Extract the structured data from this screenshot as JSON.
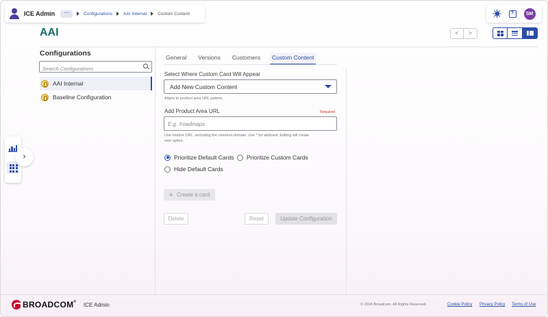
{
  "header": {
    "app_title": "ICE Admin",
    "more_label": "···",
    "breadcrumbs": [
      "Configurations",
      "AAI Internal"
    ],
    "current": "Custom Content",
    "avatar_initials": "SM"
  },
  "page": {
    "title": "AAI",
    "nav_prev": "<",
    "nav_next": ">"
  },
  "configs": {
    "title": "Configurations",
    "search_placeholder": "Search Configurations",
    "items": [
      {
        "label": "AAI Internal",
        "active": true
      },
      {
        "label": "Baseline Configuration",
        "active": false
      }
    ]
  },
  "tabs": [
    "General",
    "Versions",
    "Customers",
    "Custom Content"
  ],
  "form": {
    "select_label": "Select Where Custom Card Will Appear",
    "select_value": "Add New Custom Content",
    "select_help": "Aligns to product area URL pattern.",
    "url_label": "Add Product Area URL",
    "required": "Required",
    "url_placeholder": "E.g. /roadmaps",
    "url_help_1": "Use relative URL, excluding the common domain. Use * for wildcard. Editing will create",
    "url_help_2": "new option.",
    "radios": [
      {
        "label": "Prioritize Default Cards",
        "checked": true
      },
      {
        "label": "Prioritize Custom Cards",
        "checked": false
      },
      {
        "label": "Hide Default Cards",
        "checked": false
      }
    ],
    "create_card": "Create a card",
    "delete": "Delete",
    "reset": "Reset",
    "update": "Update Configuration"
  },
  "sidebar": {
    "expand": "›"
  },
  "footer": {
    "brand": "BROADCOM",
    "tm": "®",
    "app": "ICE Admin",
    "copyright": "© 2024 Broadcom. All Rights Reserved.",
    "links": [
      "Cookie Policy",
      "Privacy Policy",
      "Terms of Use"
    ]
  },
  "colors": {
    "accent": "#2c4da6",
    "title_teal": "#1a6d6d",
    "brand_red": "#cc092f",
    "avatar": "#7a3ea3"
  }
}
